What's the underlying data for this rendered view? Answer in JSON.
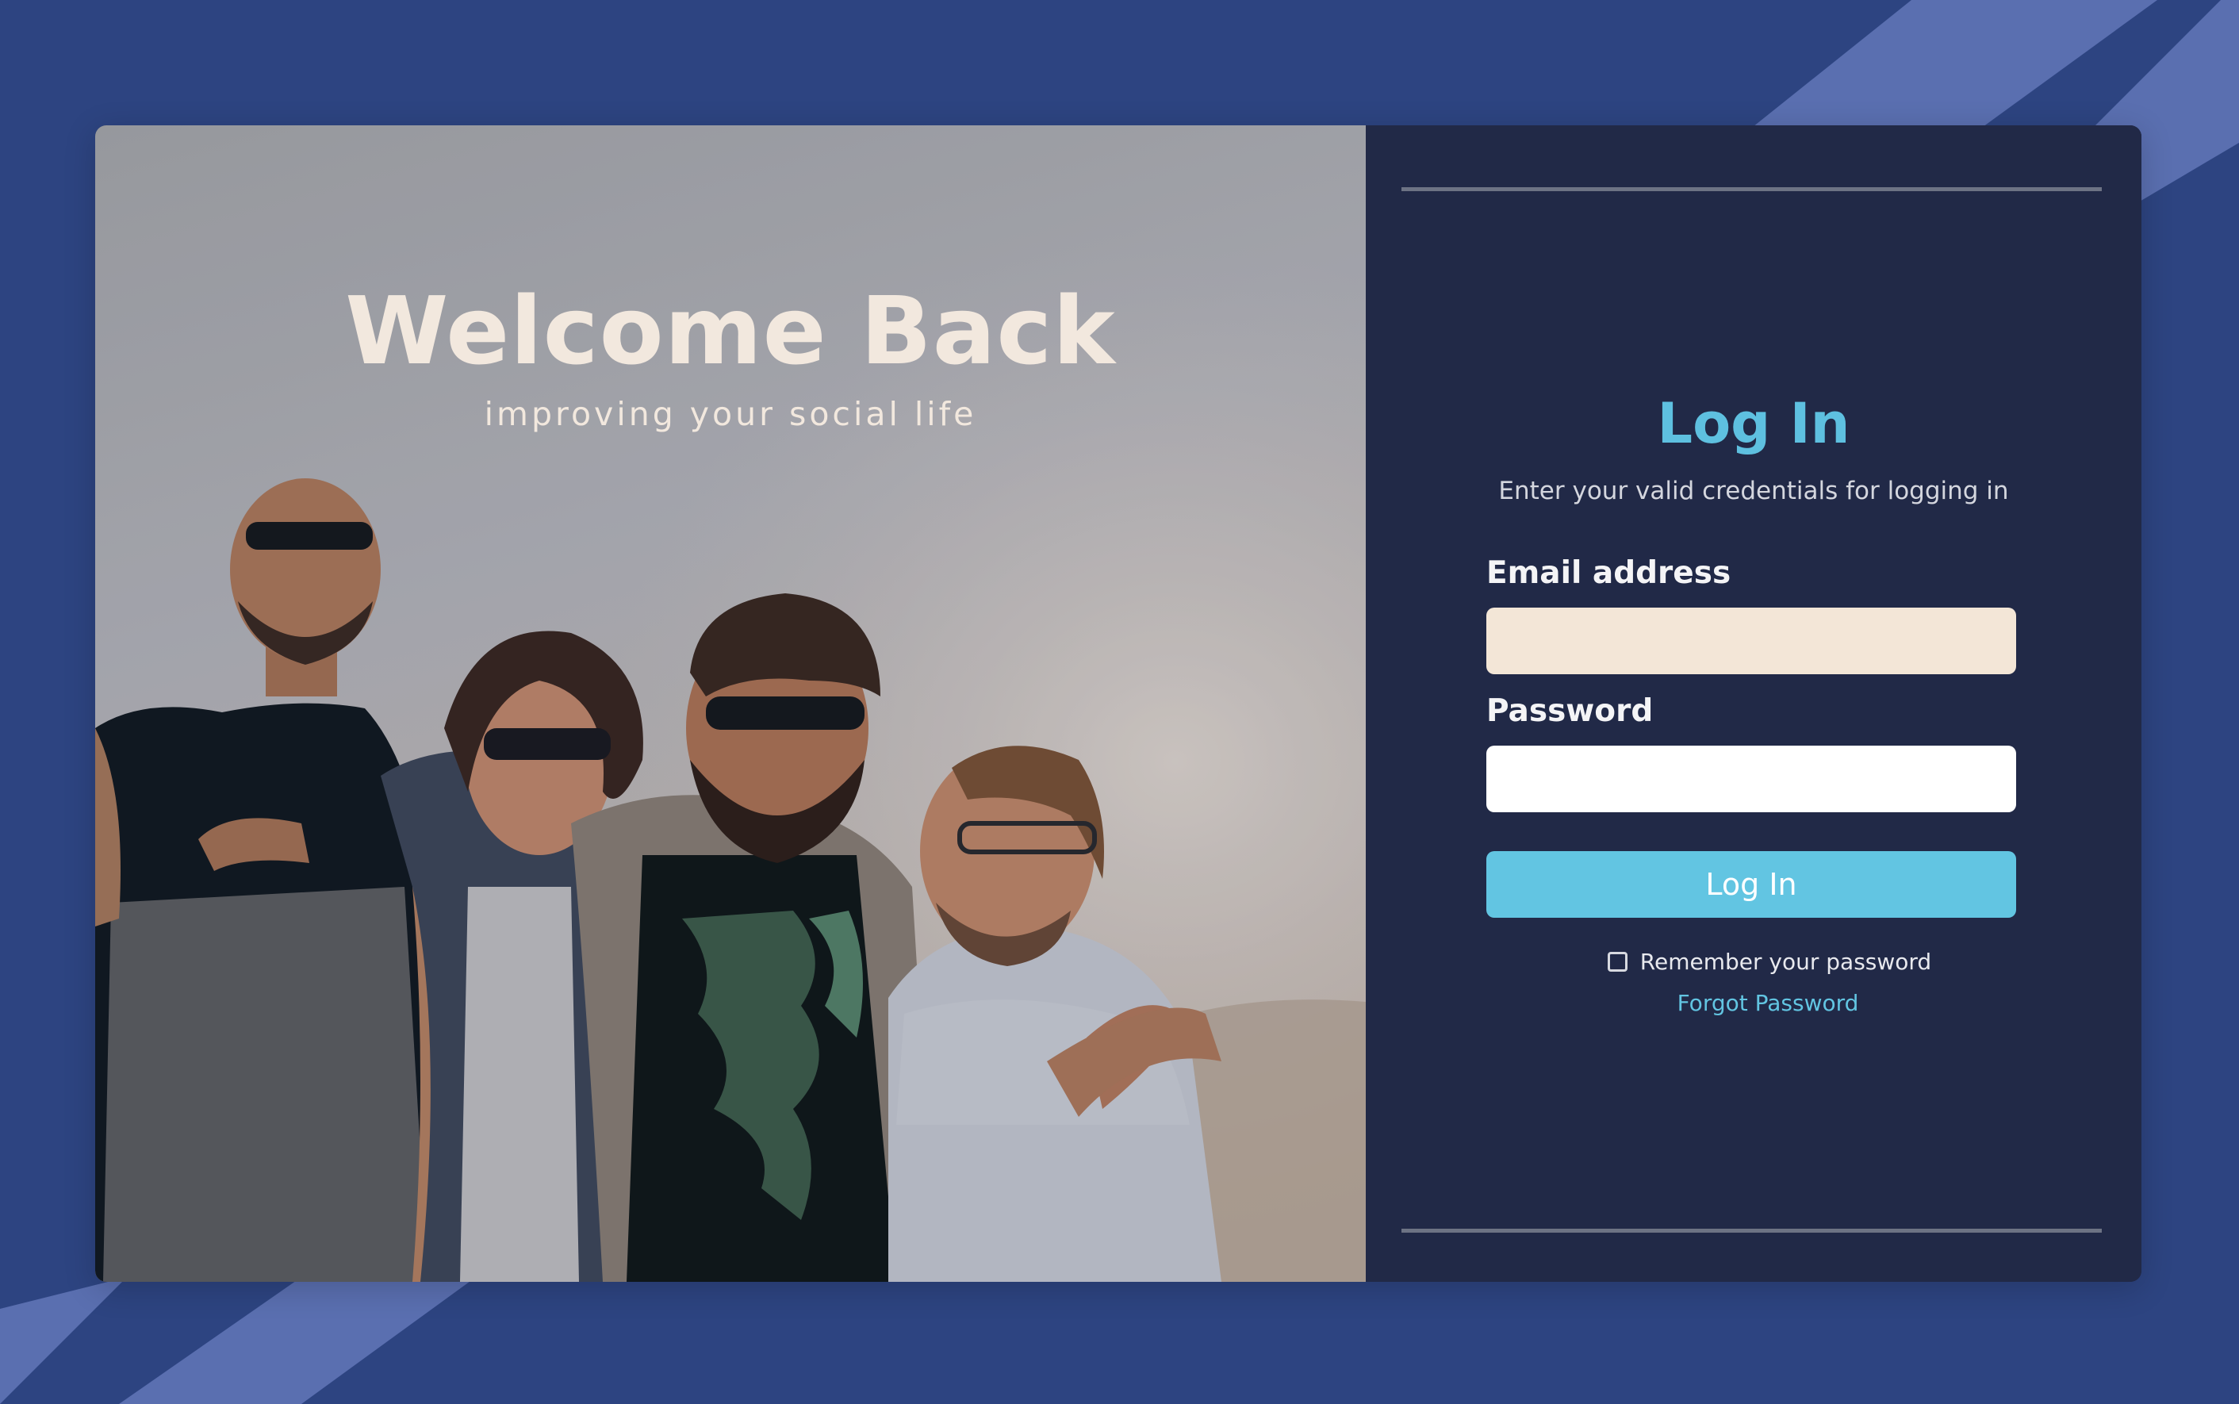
{
  "hero": {
    "title": "Welcome Back",
    "subtitle": "improving your social life",
    "image": "friends-laughing-group-photo"
  },
  "login": {
    "title": "Log In",
    "subtitle": "Enter your valid credentials for logging in",
    "email": {
      "label": "Email address",
      "value": "",
      "placeholder": ""
    },
    "password": {
      "label": "Password",
      "value": "",
      "placeholder": ""
    },
    "submit_label": "Log In",
    "remember_label": "Remember your password",
    "remember_checked": false,
    "forgot_label": "Forgot Password"
  },
  "colors": {
    "background": "#2d4481",
    "stripe": "#5a6fb0",
    "panel": "#212947",
    "accent": "#62c5e2",
    "email_field": "#f3e6d7",
    "hero_text": "#f2e8de"
  }
}
